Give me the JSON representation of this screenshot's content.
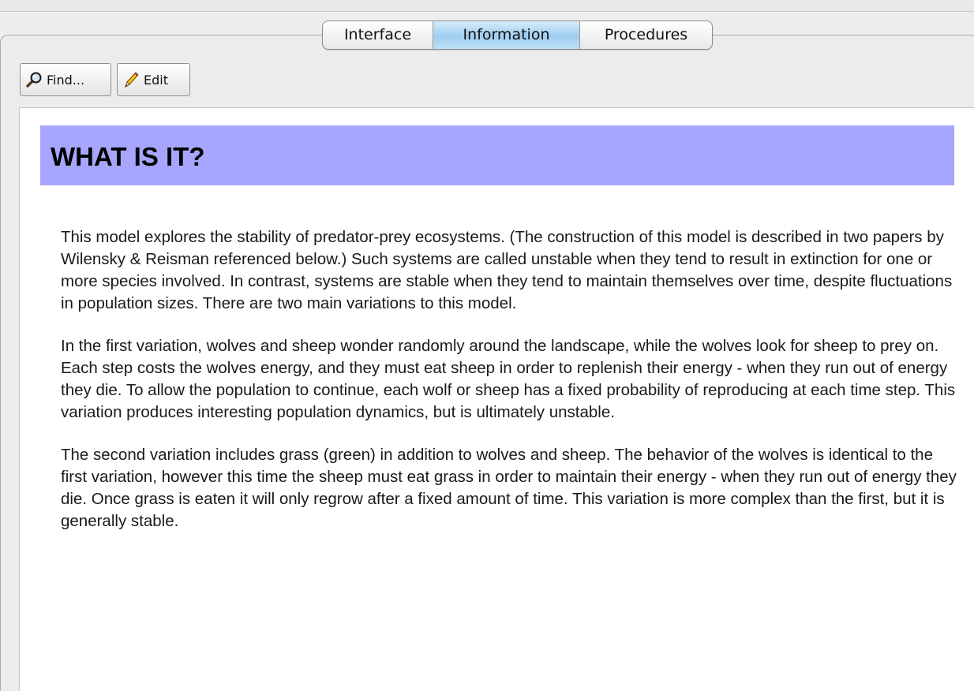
{
  "tabs": [
    {
      "label": "Interface",
      "selected": false
    },
    {
      "label": "Information",
      "selected": true
    },
    {
      "label": "Procedures",
      "selected": false
    }
  ],
  "toolbar": {
    "find_label": "Find...",
    "find_icon": "magnifier-icon",
    "edit_label": "Edit",
    "edit_icon": "pencil-icon"
  },
  "document": {
    "heading": "WHAT IS IT?",
    "heading_color": "#a6a6fe",
    "paragraphs": [
      "This model explores the stability of predator-prey ecosystems. (The construction of this model is described in two papers by Wilensky & Reisman referenced below.) Such systems are called unstable when they tend to result in extinction for one or more species involved. In contrast, systems are stable when they tend to maintain themselves over time, despite fluctuations in population sizes. There are two main variations to this model.",
      "In the first variation, wolves and sheep wonder randomly around the landscape, while the wolves look for sheep to prey on. Each step costs the wolves energy, and they must eat sheep in order to replenish their energy - when they run out of energy they die. To allow the population to continue, each wolf or sheep has a fixed probability of reproducing at each time step. This variation produces interesting population dynamics, but is ultimately unstable.",
      "The second variation includes grass (green) in addition to wolves and sheep. The behavior of the wolves is identical to the first variation, however this time the sheep must eat grass in order to maintain their energy - when they run out of energy they die. Once grass is eaten it will only regrow after a fixed amount of time. This variation is more complex than the first, but it is generally stable."
    ]
  }
}
